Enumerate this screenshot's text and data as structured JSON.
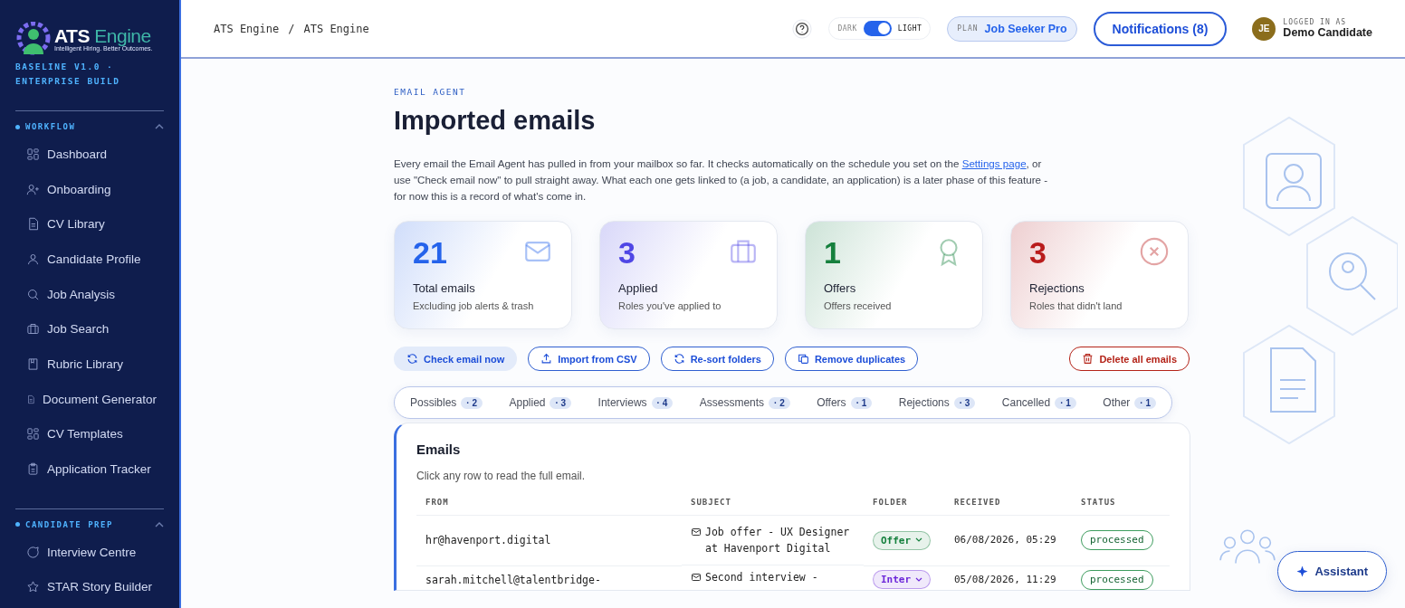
{
  "sidebar": {
    "logo_text_1": "ATS",
    "logo_text_2": "Engine",
    "logo_tagline": "Intelligent Hiring. Better Outcomes.",
    "build": "BASELINE V1.0 · ENTERPRISE BUILD",
    "sections": [
      {
        "title": "WORKFLOW",
        "expanded": true,
        "items": [
          {
            "label": "Dashboard",
            "kind": "grid"
          },
          {
            "label": "Onboarding",
            "kind": "user-plus"
          },
          {
            "label": "CV Library",
            "kind": "doc"
          },
          {
            "label": "Candidate Profile",
            "kind": "user"
          },
          {
            "label": "Job Analysis",
            "kind": "search"
          },
          {
            "label": "Job Search",
            "kind": "briefcase"
          },
          {
            "label": "Rubric Library",
            "kind": "book"
          },
          {
            "label": "Document Generator",
            "kind": "doc"
          },
          {
            "label": "CV Templates",
            "kind": "grid"
          },
          {
            "label": "Application Tracker",
            "kind": "clipboard"
          }
        ]
      },
      {
        "title": "CANDIDATE PREP",
        "expanded": true,
        "items": [
          {
            "label": "Interview Centre",
            "kind": "chat"
          },
          {
            "label": "STAR Story Builder",
            "kind": "star"
          }
        ]
      }
    ]
  },
  "topbar": {
    "breadcrumb": [
      "ATS Engine",
      "ATS Engine"
    ],
    "breadcrumb_separator": "/",
    "theme_dark": "DARK",
    "theme_light": "LIGHT",
    "light_on": true,
    "plan_label": "PLAN",
    "plan": "Job Seeker Pro",
    "notifications": "Notifications (8)",
    "avatar_initials": "JE",
    "logged_in_label": "LOGGED IN AS",
    "user": "Demo Candidate"
  },
  "page": {
    "eyebrow": "EMAIL AGENT",
    "title": "Imported emails",
    "intro_before": "Every email the Email Agent has pulled in from your mailbox so far. It checks automatically on the schedule you set on the ",
    "intro_link": "Settings page",
    "intro_after": ", or use \"Check email now\" to pull straight away. What each one gets linked to (a job, a candidate, an application) is a later phase of this feature - for now this is a record of what's come in."
  },
  "stats": [
    {
      "value": "21",
      "label": "Total emails",
      "sub": "Excluding job alerts & trash",
      "kind": "mail",
      "color": "#2563eb"
    },
    {
      "value": "3",
      "label": "Applied",
      "sub": "Roles you've applied to",
      "kind": "briefcase",
      "color": "#4f46e5"
    },
    {
      "value": "1",
      "label": "Offers",
      "sub": "Offers received",
      "kind": "award",
      "color": "#15803d"
    },
    {
      "value": "3",
      "label": "Rejections",
      "sub": "Roles that didn't land",
      "kind": "x",
      "color": "#b91c1c"
    }
  ],
  "actions": [
    {
      "label": "Check email now",
      "kind": "refresh"
    },
    {
      "label": "Import from CSV",
      "kind": "upload"
    },
    {
      "label": "Re-sort folders",
      "kind": "refresh"
    },
    {
      "label": "Remove duplicates",
      "kind": "copy"
    }
  ],
  "danger_action": "Delete all emails",
  "tabs": [
    {
      "label": "Possibles",
      "count": "· 2",
      "selected": false
    },
    {
      "label": "Applied",
      "count": "· 3",
      "selected": false
    },
    {
      "label": "Interviews",
      "count": "· 4",
      "selected": false
    },
    {
      "label": "Assessments",
      "count": "· 2",
      "selected": false
    },
    {
      "label": "Offers",
      "count": "· 1",
      "selected": false
    },
    {
      "label": "Rejections",
      "count": "· 3",
      "selected": false
    },
    {
      "label": "Cancelled",
      "count": "· 1",
      "selected": false
    },
    {
      "label": "Other",
      "count": "· 1",
      "selected": false
    }
  ],
  "table": {
    "title": "Emails",
    "subtitle": "Click any row to read the full email.",
    "columns": [
      "FROM",
      "SUBJECT",
      "FOLDER",
      "RECEIVED",
      "STATUS"
    ],
    "rows": [
      {
        "from": "hr@havenport.digital",
        "subject": "Job offer - UX Designer at Havenport Digital",
        "folder": "Offer",
        "color": "#15803d",
        "received": "06/08/2026, 05:29",
        "status": "processed"
      },
      {
        "from": "sarah.mitchell@talentbridge-",
        "subject": "Second interview -",
        "folder": "Inter",
        "color": "#6d28d9",
        "received": "05/08/2026, 11:29",
        "status": "processed"
      }
    ]
  },
  "assistant": "Assistant"
}
